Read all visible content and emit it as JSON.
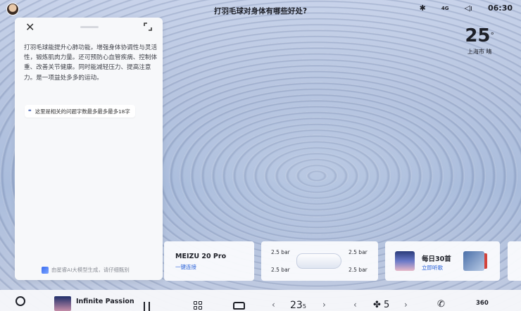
{
  "status_bar": {
    "query_title": "打羽毛球对身体有哪些好处?",
    "bluetooth_glyph": "✱",
    "signal_glyph": "4G",
    "volume_glyph": "◁ı",
    "time": "06:30"
  },
  "weather": {
    "temperature": "25",
    "degree": "°",
    "location": "上海市  晴"
  },
  "ai_panel": {
    "close_glyph": "✕",
    "answer": "打羽毛球能提升心肺功能，增强身体协调性与灵活性，锻炼肌肉力量。还可预防心血管疾病、控制体重、改善关节健康。同时能减轻压力、提高注意力。是一项益处多多的运动。",
    "related_question": "这里是相关的问题字数最多最多最多18字",
    "quote_glyph": "❝",
    "disclaimer": "由星睿AI大模型生成，请仔细甄别"
  },
  "cards": {
    "phone": {
      "name": "MEIZU 20 Pro",
      "action": "一键连接"
    },
    "tires": {
      "front_left": "2.5 bar",
      "front_right": "2.5 bar",
      "rear_left": "2.5 bar",
      "rear_right": "2.5 bar"
    },
    "music": {
      "title": "每日30首",
      "action": "立即听歌"
    }
  },
  "dock": {
    "now_playing": "Infinite Passion",
    "temperature": "23",
    "temperature_decimal": "5",
    "fan_glyph": "✤",
    "fan_level": "5",
    "left_glyph": "‹",
    "right_glyph": "›",
    "phone_glyph": "✆",
    "view_label": "360"
  }
}
